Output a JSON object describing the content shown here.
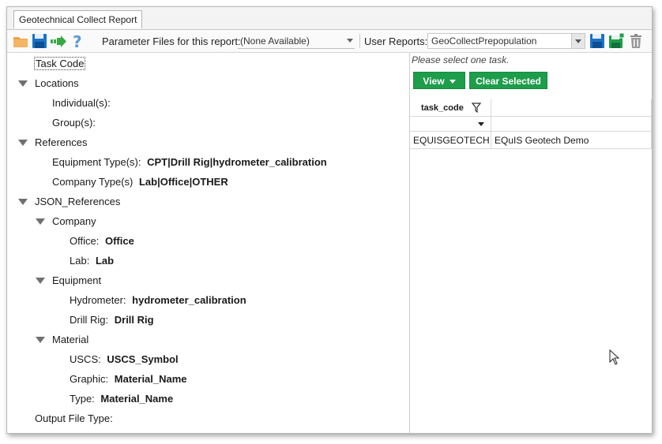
{
  "tab": {
    "title": "Geotechnical Collect Report"
  },
  "toolbar": {
    "param_label": "Parameter Files for this report:",
    "param_value": "(None Available)",
    "user_reports_label": "User Reports:",
    "user_reports_value": "GeoCollectPrepopulation"
  },
  "tree": {
    "task_code": "Task Code",
    "locations": {
      "label": "Locations",
      "individual": "Individual(s):",
      "group": "Group(s):"
    },
    "references": {
      "label": "References",
      "equipment_label": "Equipment Type(s):",
      "equipment_value": "CPT|Drill Rig|hydrometer_calibration",
      "company_label": "Company Type(s)",
      "company_value": "Lab|Office|OTHER"
    },
    "json_refs": {
      "label": "JSON_References",
      "company": {
        "label": "Company",
        "office_label": "Office:",
        "office_value": "Office",
        "lab_label": "Lab:",
        "lab_value": "Lab"
      },
      "equipment": {
        "label": "Equipment",
        "hydrometer_label": "Hydrometer:",
        "hydrometer_value": "hydrometer_calibration",
        "drill_label": "Drill Rig:",
        "drill_value": "Drill Rig"
      },
      "material": {
        "label": "Material",
        "uscs_label": "USCS:",
        "uscs_value": "USCS_Symbol",
        "graphic_label": "Graphic:",
        "graphic_value": "Material_Name",
        "type_label": "Type:",
        "type_value": "Material_Name"
      }
    },
    "output_file_type": "Output File Type:"
  },
  "right": {
    "hint": "Please select one task.",
    "view_button": "View",
    "clear_button": "Clear Selected",
    "grid": {
      "header": "task_code",
      "rows": [
        {
          "code": "EQUISGEOTECH",
          "name": "EQuIS Geotech Demo"
        }
      ]
    }
  },
  "colors": {
    "accent_green": "#1e9d4b",
    "save_blue": "#1a73c9",
    "folder_orange": "#f0a14a"
  }
}
